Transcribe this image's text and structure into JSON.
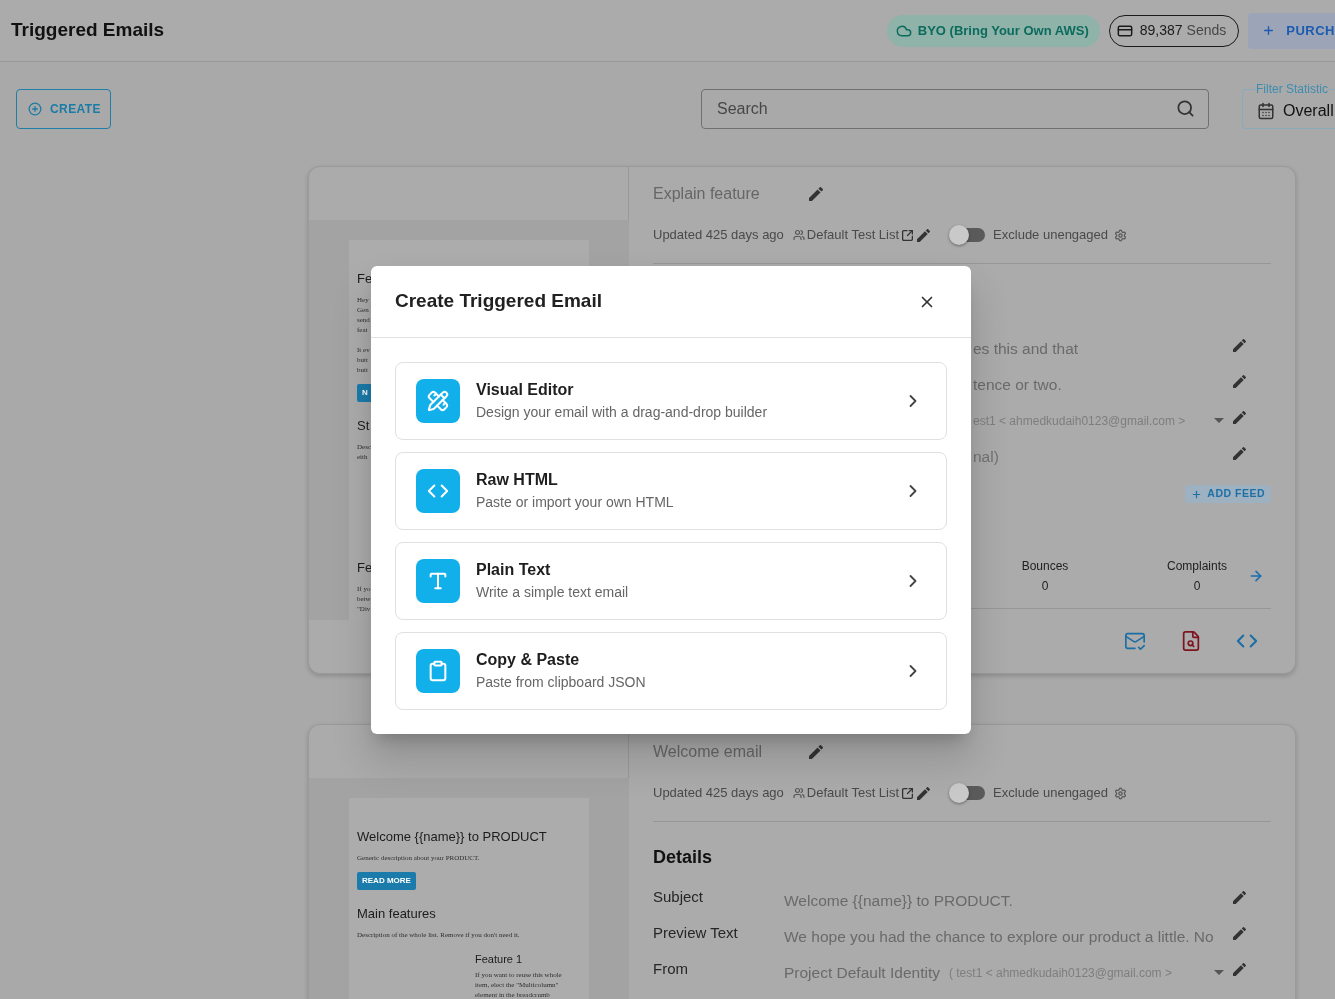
{
  "header": {
    "title": "Triggered Emails",
    "byo": "BYO (Bring Your Own AWS)",
    "sends": {
      "count": "89,387",
      "label": "Sends"
    },
    "purchase": "PURCH"
  },
  "toolbar": {
    "create": "CREATE",
    "search": {
      "placeholder": "Search"
    },
    "filter": {
      "label": "Filter Statistic",
      "value": "Overall"
    }
  },
  "cards": [
    {
      "name": "Explain feature",
      "updated": "Updated 425 days ago",
      "list": "Default Test List",
      "exclude_unengaged": {
        "label": "Exclude unengaged",
        "on": false
      },
      "preview": {
        "top": [
          {
            "kind": "heading",
            "text": "Fe"
          },
          {
            "kind": "paragraph",
            "lines": [
              "Hey",
              "Gen",
              "send",
              "feat"
            ]
          },
          {
            "kind": "paragraph",
            "lines": [
              "It ev",
              "butt",
              "butt"
            ]
          },
          {
            "kind": "button",
            "text": "N"
          },
          {
            "kind": "heading",
            "text": "St"
          },
          {
            "kind": "paragraph",
            "lines": [
              "Desc",
              "eith"
            ]
          }
        ],
        "bottom": [
          {
            "kind": "heading",
            "text": "Fe"
          },
          {
            "kind": "paragraph",
            "lines": [
              "If yo",
              "betw",
              "\"Div"
            ]
          }
        ]
      },
      "fields": [
        {
          "kind": "text",
          "value": "es this and that"
        },
        {
          "kind": "text",
          "value": "tence or two."
        },
        {
          "kind": "from",
          "identity": "est1 < ahmedkudaih0123@gmail.com >"
        },
        {
          "kind": "placeholder",
          "placeholder": "nal)"
        }
      ],
      "add_feed": "ADD FEED",
      "stats": [
        {
          "label": "Bounces",
          "value": "0"
        },
        {
          "label": "Complaints",
          "value": "0"
        }
      ]
    },
    {
      "name": "Welcome email",
      "updated": "Updated 425 days ago",
      "list": "Default Test List",
      "exclude_unengaged": {
        "label": "Exclude unengaged",
        "on": false
      },
      "preview": {
        "top": [
          {
            "kind": "heading",
            "text": "Welcome {{name}} to PRODUCT"
          },
          {
            "kind": "paragraph",
            "lines": [
              "Generic description about your PRODUCT."
            ]
          },
          {
            "kind": "button",
            "text": "READ MORE"
          },
          {
            "kind": "heading",
            "text": "Main features"
          },
          {
            "kind": "paragraph",
            "lines": [
              "Description of the whole list. Remove if you don't need it."
            ]
          },
          {
            "kind": "feature",
            "title": "Feature 1",
            "lines": [
              "If you want to reuse this whole",
              "item, elect the \"Multicolumn\"",
              "element in the breadcrumb"
            ]
          }
        ]
      },
      "details_title": "Details",
      "fields": [
        {
          "kind": "text",
          "label": "Subject",
          "value": "Welcome {{name}} to PRODUCT."
        },
        {
          "kind": "text",
          "label": "Preview Text",
          "value": "We hope you had the chance to explore our product a little. No"
        },
        {
          "kind": "from",
          "label": "From",
          "value": "Project Default Identity",
          "identity": "( test1 < ahmedkudaih0123@gmail.com >"
        }
      ]
    }
  ],
  "modal": {
    "title": "Create Triggered Email",
    "options": [
      {
        "kind": "visual",
        "title": "Visual Editor",
        "description": "Design your email with a drag-and-drop builder"
      },
      {
        "kind": "html",
        "title": "Raw HTML",
        "description": "Paste or import your own HTML"
      },
      {
        "kind": "text",
        "title": "Plain Text",
        "description": "Write a simple text email"
      },
      {
        "kind": "paste",
        "title": "Copy & Paste",
        "description": "Paste from clipboard JSON"
      }
    ]
  }
}
